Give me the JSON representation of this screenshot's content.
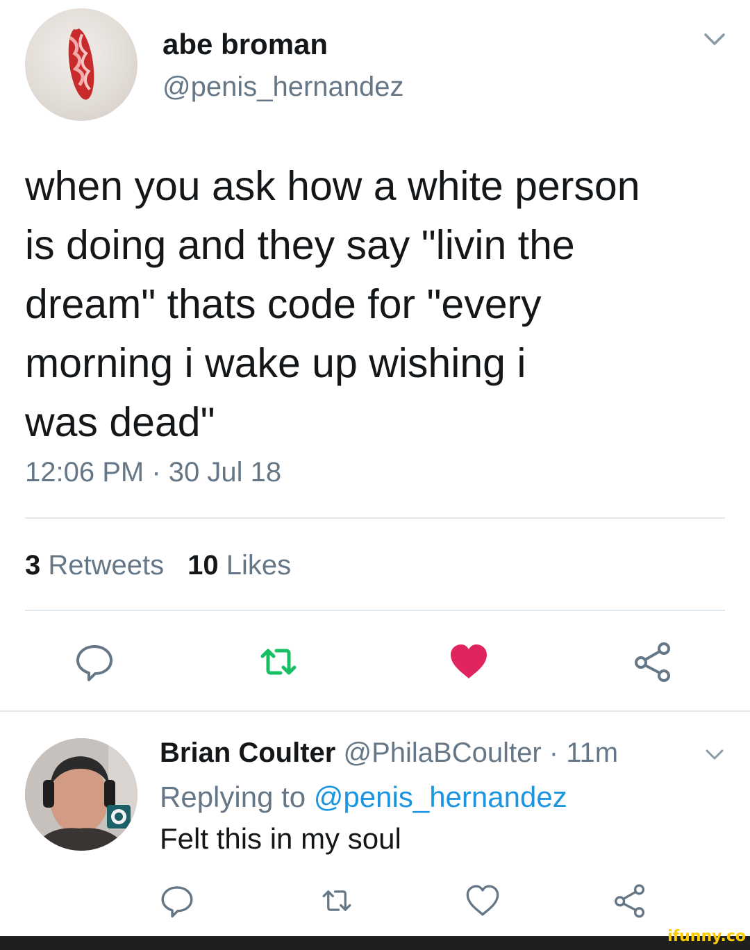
{
  "tweet": {
    "display_name": "abe broman",
    "handle": "@penis_hernandez",
    "text": "when you ask how a white person\nis doing and they say \"livin the\ndream\" thats code for \"every\nmorning i wake up wishing i\nwas dead\"",
    "timestamp": "12:06 PM · 30 Jul 18",
    "stats": {
      "retweets_count": "3",
      "retweets_label": "Retweets",
      "likes_count": "10",
      "likes_label": "Likes"
    },
    "liked": true
  },
  "reply": {
    "display_name": "Brian Coulter",
    "handle_time": "@PhilaBCoulter · 11m",
    "replying_prefix": "Replying to",
    "replying_handle": "@penis_hernandez",
    "text": "Felt this in my soul",
    "liked": false
  },
  "watermark": "ifunny.co",
  "colors": {
    "text": "#14171a",
    "secondary": "#657786",
    "link": "#1b95e0",
    "retweet_green": "#17bf63",
    "like_red": "#e0245e",
    "divider": "#e1e8ed"
  },
  "icons": {
    "reply": "speech-bubble-icon",
    "retweet": "retweet-icon",
    "like": "heart-icon",
    "share": "share-icon",
    "menu": "chevron-down-icon"
  }
}
